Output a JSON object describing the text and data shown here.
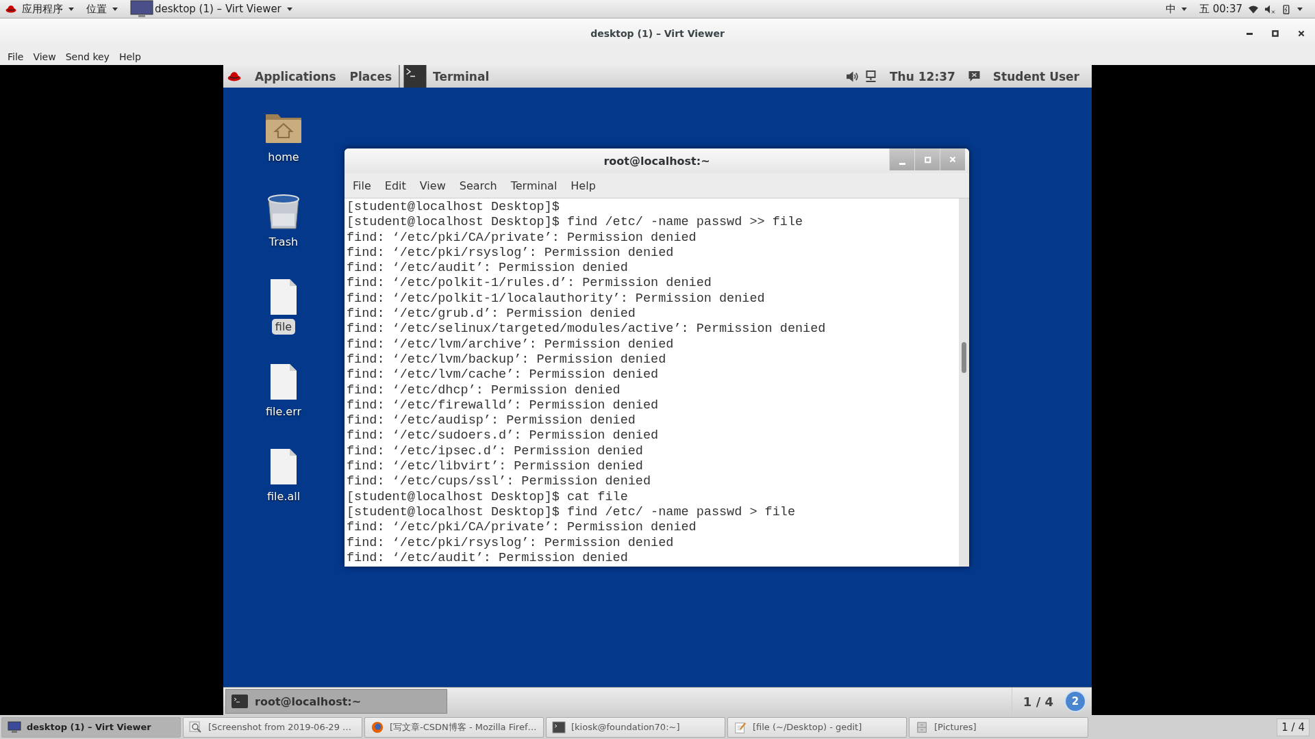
{
  "host_panel": {
    "apps_menu": "应用程序",
    "places_menu": "位置",
    "window_menu": "desktop (1) – Virt Viewer",
    "input_method": "中",
    "clock": "五 00:37"
  },
  "viewer": {
    "title": "desktop (1) – Virt Viewer",
    "menu": [
      "File",
      "View",
      "Send key",
      "Help"
    ]
  },
  "guest": {
    "top_bar": {
      "applications": "Applications",
      "places": "Places",
      "task": "Terminal",
      "clock": "Thu 12:37",
      "user": "Student User"
    },
    "desktop_icons": [
      {
        "label": "home",
        "kind": "home",
        "selected": false
      },
      {
        "label": "Trash",
        "kind": "trash",
        "selected": false
      },
      {
        "label": "file",
        "kind": "file",
        "selected": true
      },
      {
        "label": "file.err",
        "kind": "file",
        "selected": false
      },
      {
        "label": "file.all",
        "kind": "file",
        "selected": false
      }
    ],
    "terminal": {
      "title": "root@localhost:~",
      "menu": [
        "File",
        "Edit",
        "View",
        "Search",
        "Terminal",
        "Help"
      ],
      "lines": [
        "[student@localhost Desktop]$",
        "[student@localhost Desktop]$ find /etc/ -name passwd >> file",
        "find: ‘/etc/pki/CA/private’: Permission denied",
        "find: ‘/etc/pki/rsyslog’: Permission denied",
        "find: ‘/etc/audit’: Permission denied",
        "find: ‘/etc/polkit-1/rules.d’: Permission denied",
        "find: ‘/etc/polkit-1/localauthority’: Permission denied",
        "find: ‘/etc/grub.d’: Permission denied",
        "find: ‘/etc/selinux/targeted/modules/active’: Permission denied",
        "find: ‘/etc/lvm/archive’: Permission denied",
        "find: ‘/etc/lvm/backup’: Permission denied",
        "find: ‘/etc/lvm/cache’: Permission denied",
        "find: ‘/etc/dhcp’: Permission denied",
        "find: ‘/etc/firewalld’: Permission denied",
        "find: ‘/etc/audisp’: Permission denied",
        "find: ‘/etc/sudoers.d’: Permission denied",
        "find: ‘/etc/ipsec.d’: Permission denied",
        "find: ‘/etc/libvirt’: Permission denied",
        "find: ‘/etc/cups/ssl’: Permission denied",
        "[student@localhost Desktop]$ cat file",
        "[student@localhost Desktop]$ find /etc/ -name passwd > file",
        "find: ‘/etc/pki/CA/private’: Permission denied",
        "find: ‘/etc/pki/rsyslog’: Permission denied",
        "find: ‘/etc/audit’: Permission denied"
      ]
    },
    "bottom_panel": {
      "task": "root@localhost:~",
      "workspace": "1 / 4",
      "badge": "2"
    }
  },
  "taskbar": {
    "items": [
      {
        "label": "desktop (1) – Virt Viewer",
        "kind": "monitor",
        "selected": true
      },
      {
        "label": "[Screenshot from 2019-06-29 …",
        "kind": "viewer",
        "selected": false
      },
      {
        "label": "[写文章-CSDN博客 - Mozilla Firef…",
        "kind": "browser",
        "selected": false
      },
      {
        "label": "[kiosk@foundation70:~]",
        "kind": "terminal",
        "selected": false
      },
      {
        "label": "[file (~/Desktop) - gedit]",
        "kind": "editor",
        "selected": false
      },
      {
        "label": "[Pictures]",
        "kind": "folder",
        "selected": false
      }
    ],
    "workspace": "1 / 4"
  }
}
